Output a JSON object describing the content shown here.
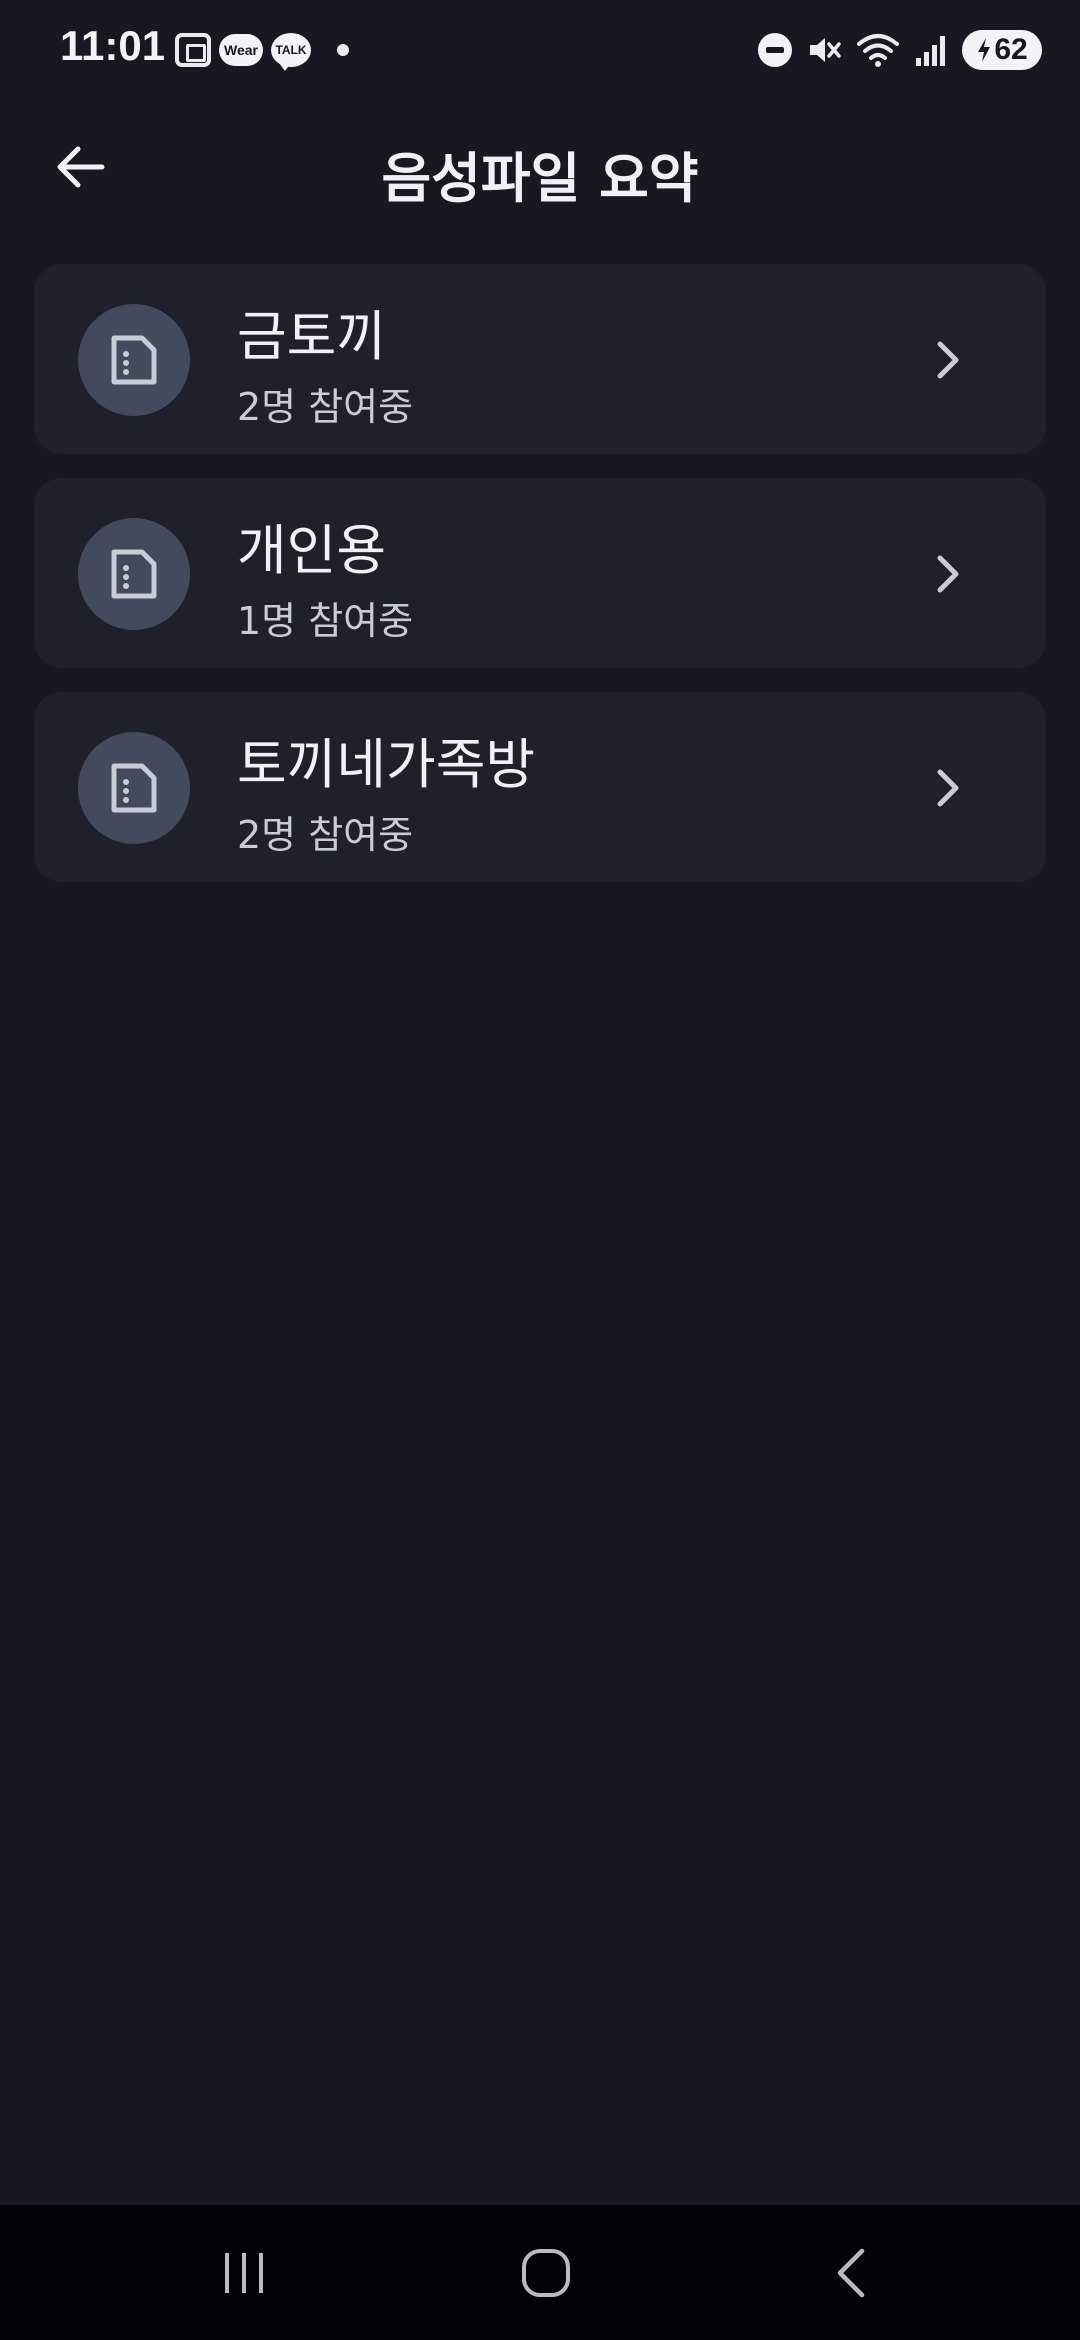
{
  "status_bar": {
    "time": "11:01",
    "wear_label": "Wear",
    "talk_label": "TALK",
    "battery_level": "62",
    "icons": [
      "screenshot-icon",
      "wear-app-icon",
      "kakaotalk-icon",
      "notification-dot",
      "dnd-icon",
      "mute-icon",
      "wifi-icon",
      "signal-icon",
      "battery-charging-icon"
    ]
  },
  "header": {
    "title": "음성파일 요약",
    "back_icon": "arrow-left-icon"
  },
  "rooms": [
    {
      "name": "금토끼",
      "participants": "2명 참여중"
    },
    {
      "name": "개인용",
      "participants": "1명 참여중"
    },
    {
      "name": "토끼네가족방",
      "participants": "2명 참여중"
    }
  ],
  "nav_bar": {
    "buttons": [
      "recent-apps-icon",
      "home-icon",
      "back-icon"
    ]
  },
  "colors": {
    "background": "#171821",
    "card": "#1F202C",
    "avatar": "#444A5E",
    "text_primary": "#F0F1F6",
    "text_secondary": "#C9CBD6"
  }
}
